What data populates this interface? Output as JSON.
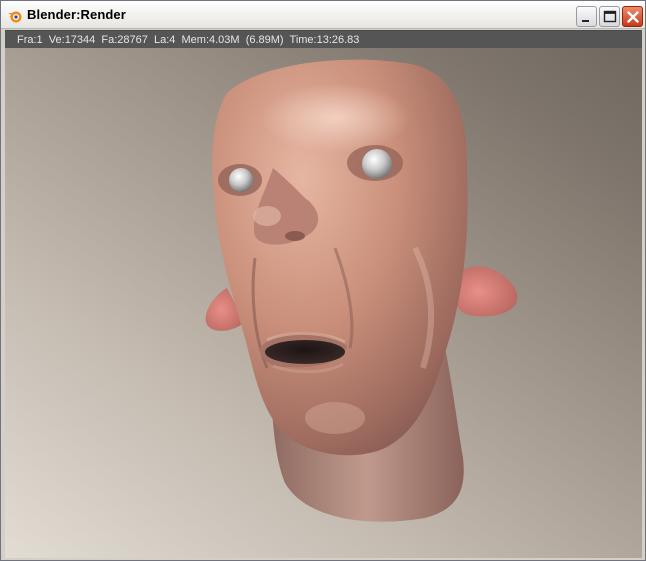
{
  "window": {
    "title": "Blender:Render",
    "icon": "blender-logo-icon",
    "controls": [
      "minimize-icon",
      "maximize-icon",
      "close-icon"
    ]
  },
  "status": {
    "text": "Fra:1  Ve:17344  Fa:28767  La:4  Mem:4.03M  (6.89M)  Time:13:26.83"
  },
  "render": {
    "subject": "3D rendered bald head with a surprised expression",
    "colors": {
      "skin": "#c98f7a",
      "background_light": "#e2dcd3",
      "background_dark": "#706860"
    }
  }
}
